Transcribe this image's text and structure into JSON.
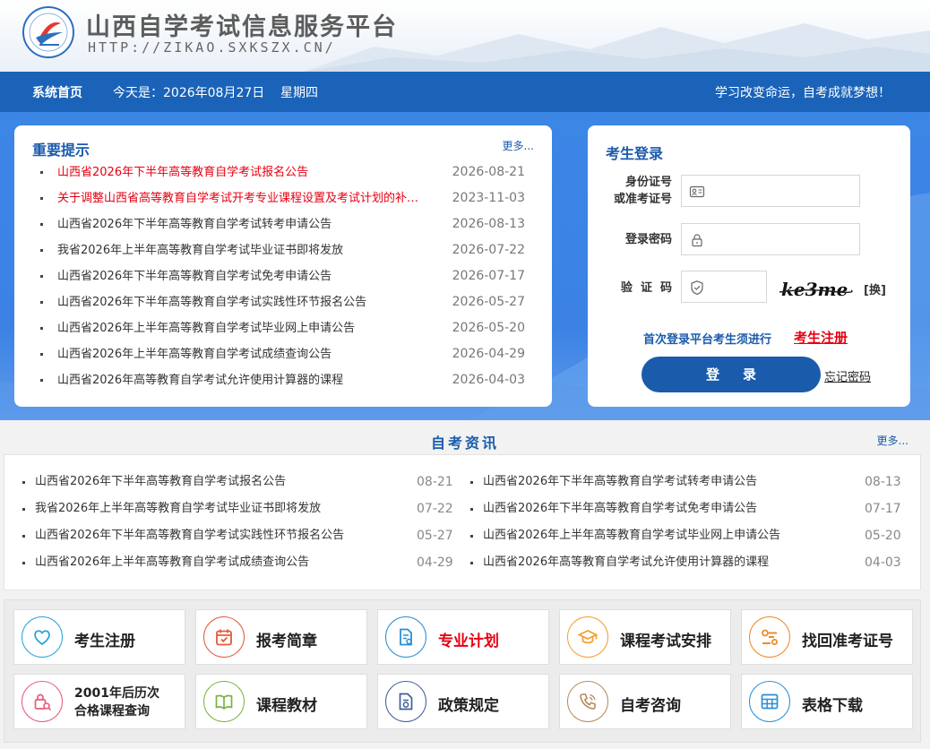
{
  "header": {
    "title": "山西自学考试信息服务平台",
    "url": "HTTP://ZIKAO.SXKSZX.CN/"
  },
  "navbar": {
    "home": "系统首页",
    "today": "今天是：2026年08月27日    星期四",
    "slogan": "学习改变命运，自考成就梦想！"
  },
  "notice": {
    "title": "重要提示",
    "more": "更多...",
    "items": [
      {
        "title": "山西省2026年下半年高等教育自学考试报名公告",
        "date": "2026-08-21",
        "highlight": true
      },
      {
        "title": "关于调整山西省高等教育自学考试开考专业课程设置及考试计划的补…",
        "date": "2023-11-03",
        "highlight": true
      },
      {
        "title": "山西省2026年下半年高等教育自学考试转考申请公告",
        "date": "2026-08-13",
        "highlight": false
      },
      {
        "title": "我省2026年上半年高等教育自学考试毕业证书即将发放",
        "date": "2026-07-22",
        "highlight": false
      },
      {
        "title": "山西省2026年下半年高等教育自学考试免考申请公告",
        "date": "2026-07-17",
        "highlight": false
      },
      {
        "title": "山西省2026年下半年高等教育自学考试实践性环节报名公告",
        "date": "2026-05-27",
        "highlight": false
      },
      {
        "title": "山西省2026年上半年高等教育自学考试毕业网上申请公告",
        "date": "2026-05-20",
        "highlight": false
      },
      {
        "title": "山西省2026年上半年高等教育自学考试成绩查询公告",
        "date": "2026-04-29",
        "highlight": false
      },
      {
        "title": "山西省2026年高等教育自学考试允许使用计算器的课程",
        "date": "2026-04-03",
        "highlight": false
      }
    ]
  },
  "login": {
    "title": "考生登录",
    "id_label_1": "身份证号",
    "id_label_2": "或准考证号",
    "id_value": "",
    "password_label": "登录密码",
    "password_value": "",
    "captcha_label": "验  证  码",
    "captcha_value": "",
    "captcha_text": "ke3me",
    "swap_label": "[换]",
    "register_hint": "首次登录平台考生须进行",
    "register_link": "考生注册",
    "submit_label": "登录",
    "forget_label": "忘记密码",
    "accent": "#1a5bab"
  },
  "news": {
    "title": "自考资讯",
    "more": "更多...",
    "items": [
      {
        "title": "山西省2026年下半年高等教育自学考试报名公告",
        "date": "08-21"
      },
      {
        "title": "山西省2026年下半年高等教育自学考试转考申请公告",
        "date": "08-13"
      },
      {
        "title": "我省2026年上半年高等教育自学考试毕业证书即将发放",
        "date": "07-22"
      },
      {
        "title": "山西省2026年下半年高等教育自学考试免考申请公告",
        "date": "07-17"
      },
      {
        "title": "山西省2026年下半年高等教育自学考试实践性环节报名公告",
        "date": "05-27"
      },
      {
        "title": "山西省2026年上半年高等教育自学考试毕业网上申请公告",
        "date": "05-20"
      },
      {
        "title": "山西省2026年上半年高等教育自学考试成绩查询公告",
        "date": "04-29"
      },
      {
        "title": "山西省2026年高等教育自学考试允许使用计算器的课程",
        "date": "04-03"
      }
    ]
  },
  "quick_links": [
    {
      "label": "考生注册",
      "icon": "heart-icon",
      "color": "#2ba4d9",
      "red": false
    },
    {
      "label": "报考简章",
      "icon": "calendar-icon",
      "color": "#e25b3a",
      "red": false
    },
    {
      "label": "专业计划",
      "icon": "document-icon",
      "color": "#2a8fd6",
      "red": true
    },
    {
      "label": "课程考试安排",
      "icon": "graduation-cap-icon",
      "color": "#f0a030",
      "red": false
    },
    {
      "label": "找回准考证号",
      "icon": "id-search-icon",
      "color": "#ee8a2a",
      "red": false
    },
    {
      "label": "2001年后历次\n合格课程查询",
      "label_line1": "2001年后历次",
      "label_line2": "合格课程查询",
      "icon": "lock-search-icon",
      "color": "#e85a7a",
      "red": false
    },
    {
      "label": "课程教材",
      "icon": "book-icon",
      "color": "#7cb342",
      "red": false
    },
    {
      "label": "政策规定",
      "icon": "policy-doc-icon",
      "color": "#3f5f9c",
      "red": false
    },
    {
      "label": "自考咨询",
      "icon": "phone-icon",
      "color": "#b58a5a",
      "red": false
    },
    {
      "label": "表格下载",
      "icon": "table-icon",
      "color": "#2a8fd6",
      "red": false
    }
  ]
}
